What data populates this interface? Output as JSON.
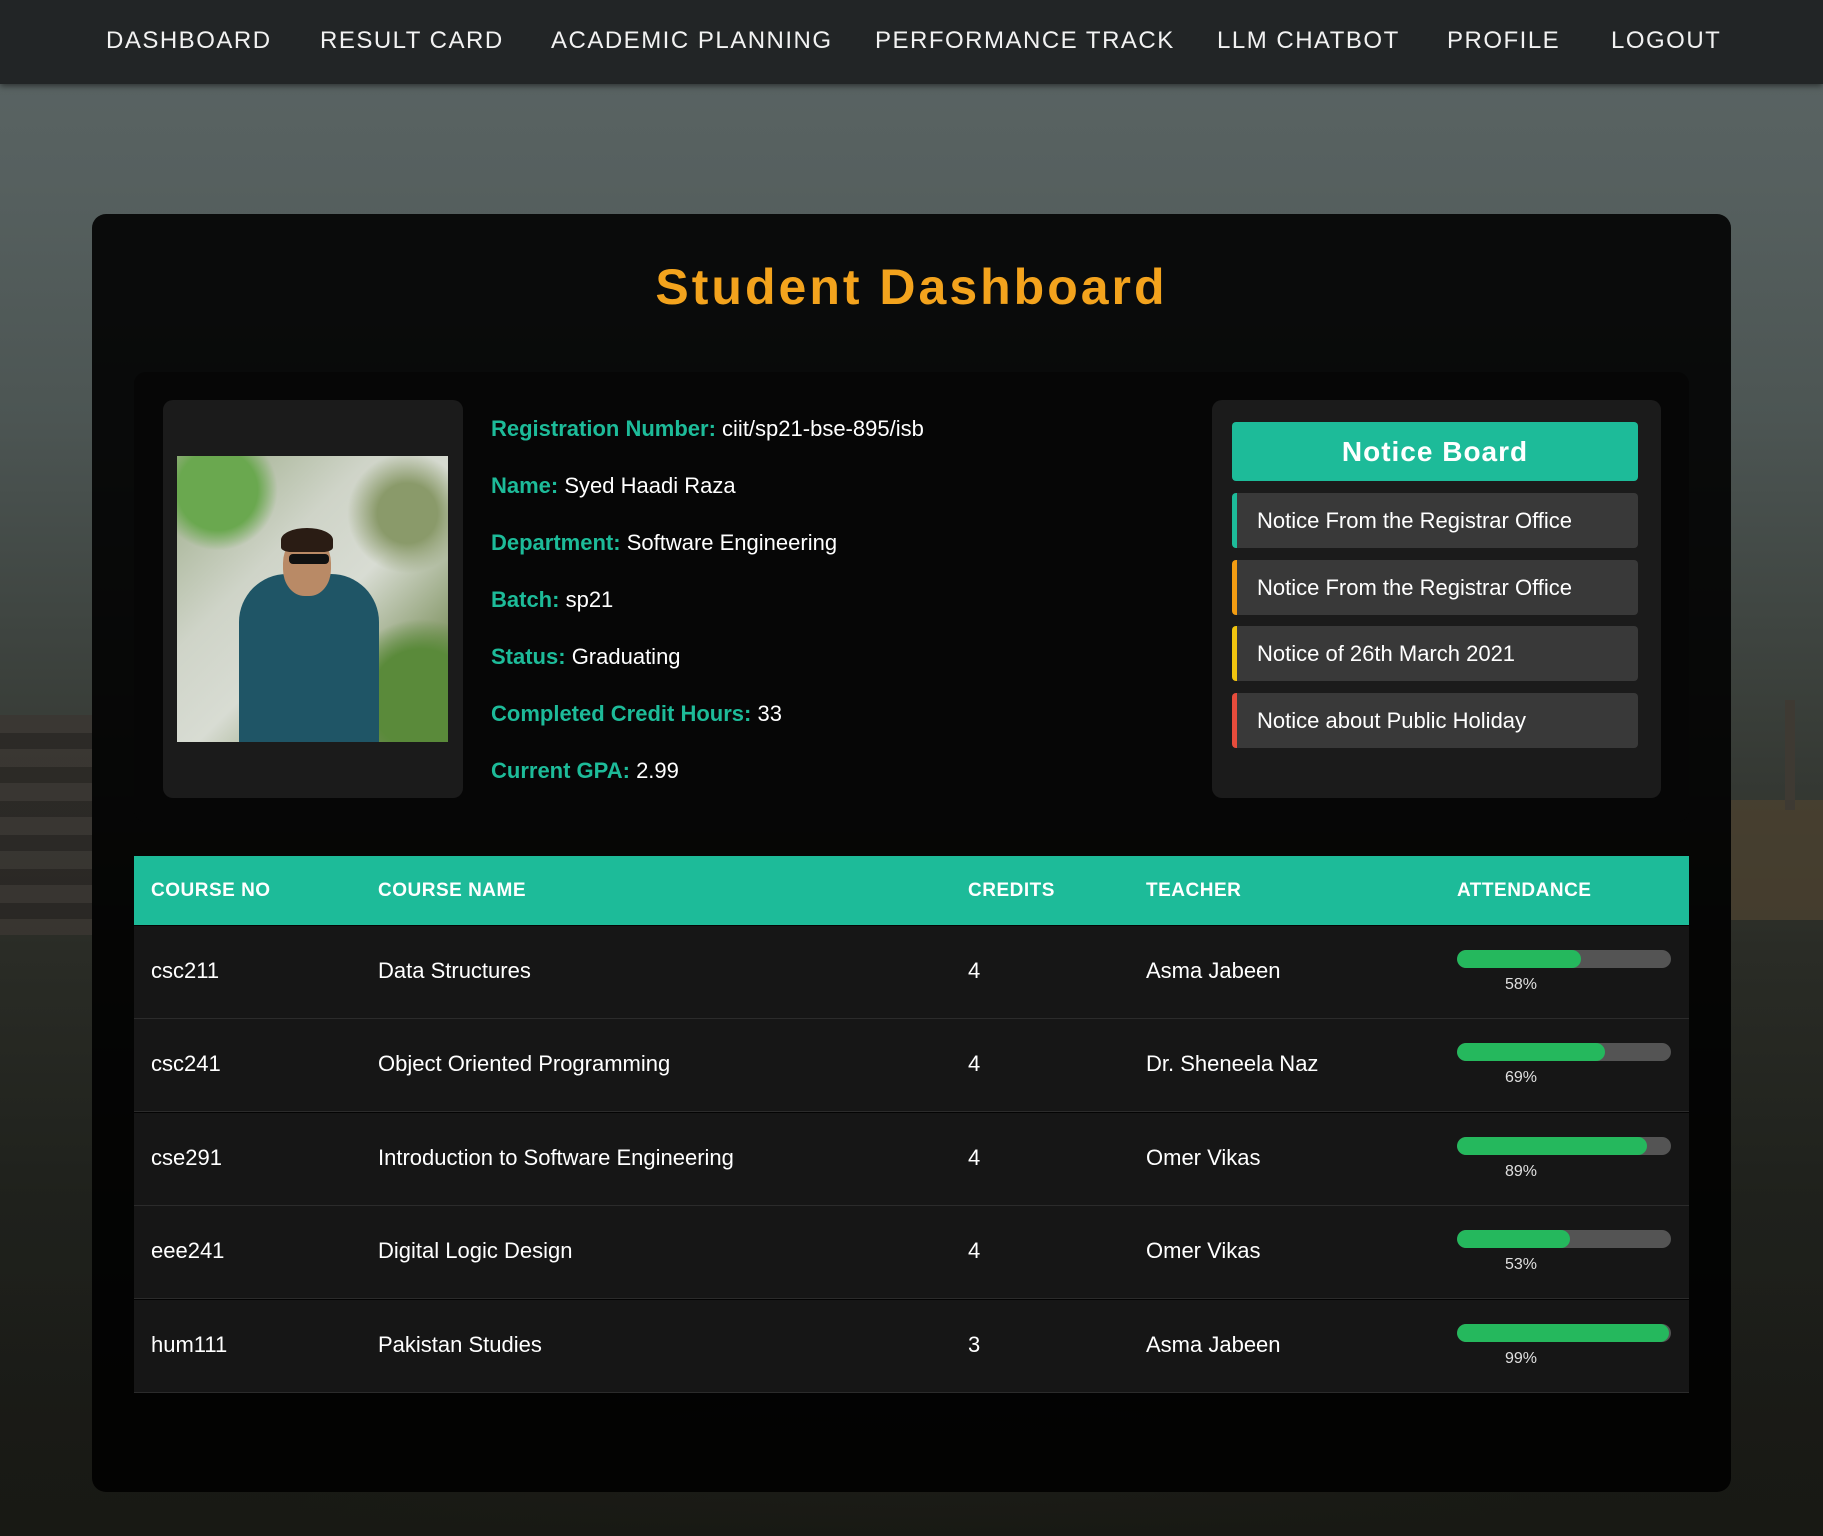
{
  "nav": {
    "items": [
      "DASHBOARD",
      "RESULT CARD",
      "ACADEMIC PLANNING",
      "PERFORMANCE TRACK",
      "LLM CHATBOT",
      "PROFILE",
      "LOGOUT"
    ]
  },
  "page": {
    "title": "Student Dashboard"
  },
  "student": {
    "registration_label": "Registration Number:",
    "registration": "ciit/sp21-bse-895/isb",
    "name_label": "Name:",
    "name": "Syed Haadi Raza",
    "department_label": "Department:",
    "department": "Software Engineering",
    "batch_label": "Batch:",
    "batch": "sp21",
    "status_label": "Status:",
    "status": "Graduating",
    "credits_label": "Completed Credit Hours:",
    "credits": "33",
    "gpa_label": "Current GPA:",
    "gpa": "2.99"
  },
  "notice_board": {
    "title": "Notice Board",
    "notices": [
      {
        "text": "Notice From the Registrar Office",
        "color": "#1dbb99"
      },
      {
        "text": "Notice From the Registrar Office",
        "color": "#f39c12"
      },
      {
        "text": "Notice of 26th March 2021",
        "color": "#f1c40f"
      },
      {
        "text": "Notice about Public Holiday",
        "color": "#e74c3c"
      }
    ]
  },
  "table": {
    "headers": [
      "COURSE NO",
      "COURSE NAME",
      "CREDITS",
      "TEACHER",
      "ATTENDANCE"
    ],
    "rows": [
      {
        "course_no": "csc211",
        "course_name": "Data Structures",
        "credits": "4",
        "teacher": "Asma Jabeen",
        "attendance": "58%",
        "attendance_value": 58
      },
      {
        "course_no": "csc241",
        "course_name": "Object Oriented Programming",
        "credits": "4",
        "teacher": "Dr. Sheneela Naz",
        "attendance": "69%",
        "attendance_value": 69
      },
      {
        "course_no": "cse291",
        "course_name": "Introduction to Software Engineering",
        "credits": "4",
        "teacher": "Omer Vikas",
        "attendance": "89%",
        "attendance_value": 89
      },
      {
        "course_no": "eee241",
        "course_name": "Digital Logic Design",
        "credits": "4",
        "teacher": "Omer Vikas",
        "attendance": "53%",
        "attendance_value": 53
      },
      {
        "course_no": "hum111",
        "course_name": "Pakistan Studies",
        "credits": "3",
        "teacher": "Asma Jabeen",
        "attendance": "99%",
        "attendance_value": 99
      }
    ]
  },
  "colors": {
    "accent": "#1dbb99",
    "title": "#f3a31d",
    "attendance_bar": "#25b85d"
  }
}
